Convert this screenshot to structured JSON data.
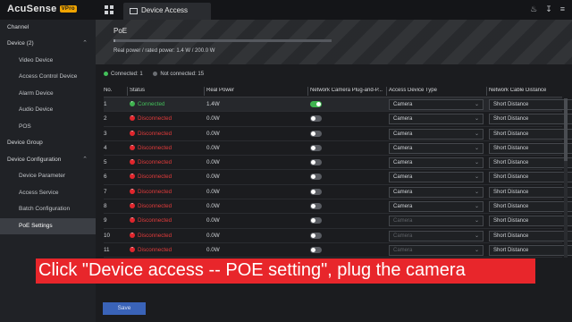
{
  "app": {
    "brand": "AcuSense",
    "brand_badge": "VPro"
  },
  "tab": {
    "label": "Device Access"
  },
  "top_icons": [
    "bell-icon",
    "download-icon",
    "menu-icon"
  ],
  "sidebar": {
    "items": [
      {
        "label": "Channel",
        "level": 0,
        "expanded": null,
        "active": false
      },
      {
        "label": "Device (2)",
        "level": 0,
        "expanded": true,
        "active": false
      },
      {
        "label": "Video Device",
        "level": 1,
        "active": false
      },
      {
        "label": "Access Control Device",
        "level": 1,
        "active": false
      },
      {
        "label": "Alarm Device",
        "level": 1,
        "active": false
      },
      {
        "label": "Audio Device",
        "level": 1,
        "active": false
      },
      {
        "label": "POS",
        "level": 1,
        "active": false
      },
      {
        "label": "Device Group",
        "level": 0,
        "expanded": null,
        "active": false
      },
      {
        "label": "Device Configuration",
        "level": 0,
        "expanded": true,
        "active": false
      },
      {
        "label": "Device Parameter",
        "level": 1,
        "active": false
      },
      {
        "label": "Access Service",
        "level": 1,
        "active": false
      },
      {
        "label": "Batch Configuration",
        "level": 1,
        "active": false
      },
      {
        "label": "PoE Settings",
        "level": 1,
        "active": true
      }
    ]
  },
  "poe": {
    "title": "PoE",
    "power_text": "Real power / rated power: 1.4 W / 200.0 W",
    "usage_fraction": 0.007
  },
  "legend": {
    "connected": "Connected: 1",
    "not_connected": "Not connected: 15"
  },
  "table": {
    "headers": [
      "No.",
      "Status",
      "Real Power",
      "Network Camera Plug-and-P...",
      "Access Device Type",
      "Network Cable Distance"
    ],
    "rows": [
      {
        "no": "1",
        "status": "Connected",
        "ok": true,
        "power": "1.4W",
        "plug": true,
        "type": "Camera",
        "distance": "Short Distance",
        "dim": false
      },
      {
        "no": "2",
        "status": "Disconnected",
        "ok": false,
        "power": "0.0W",
        "plug": false,
        "type": "Camera",
        "distance": "Short Distance",
        "dim": false
      },
      {
        "no": "3",
        "status": "Disconnected",
        "ok": false,
        "power": "0.0W",
        "plug": false,
        "type": "Camera",
        "distance": "Short Distance",
        "dim": false
      },
      {
        "no": "4",
        "status": "Disconnected",
        "ok": false,
        "power": "0.0W",
        "plug": false,
        "type": "Camera",
        "distance": "Short Distance",
        "dim": false
      },
      {
        "no": "5",
        "status": "Disconnected",
        "ok": false,
        "power": "0.0W",
        "plug": false,
        "type": "Camera",
        "distance": "Short Distance",
        "dim": false
      },
      {
        "no": "6",
        "status": "Disconnected",
        "ok": false,
        "power": "0.0W",
        "plug": false,
        "type": "Camera",
        "distance": "Short Distance",
        "dim": false
      },
      {
        "no": "7",
        "status": "Disconnected",
        "ok": false,
        "power": "0.0W",
        "plug": false,
        "type": "Camera",
        "distance": "Short Distance",
        "dim": false
      },
      {
        "no": "8",
        "status": "Disconnected",
        "ok": false,
        "power": "0.0W",
        "plug": false,
        "type": "Camera",
        "distance": "Short Distance",
        "dim": false
      },
      {
        "no": "9",
        "status": "Disconnected",
        "ok": false,
        "power": "0.0W",
        "plug": false,
        "type": "Camera",
        "distance": "Short Distance",
        "dim": true
      },
      {
        "no": "10",
        "status": "Disconnected",
        "ok": false,
        "power": "0.0W",
        "plug": false,
        "type": "Camera",
        "distance": "Short Distance",
        "dim": true
      },
      {
        "no": "11",
        "status": "Disconnected",
        "ok": false,
        "power": "0.0W",
        "plug": false,
        "type": "Camera",
        "distance": "Short Distance",
        "dim": true
      }
    ]
  },
  "caption": "Click \"Device access -- POE setting\", plug the camera",
  "save_label": "Save",
  "colors": {
    "connected": "#43c15a",
    "disconnected": "#e23b3b",
    "caption_bg": "#e8262b",
    "save_bg": "#3a63b8"
  }
}
